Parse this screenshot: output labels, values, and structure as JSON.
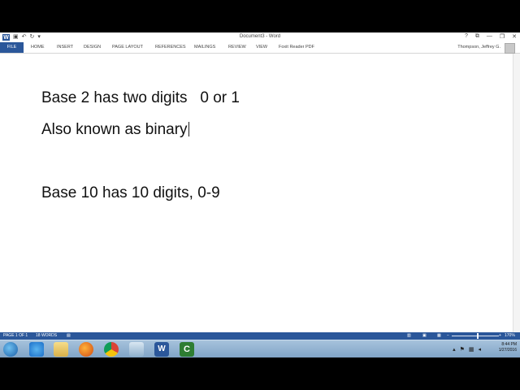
{
  "title_bar": {
    "document_title": "Document3 - Word",
    "qat": [
      "save-icon",
      "undo-icon",
      "redo-icon"
    ],
    "controls": [
      "?",
      "⧉",
      "—",
      "❐",
      "✕"
    ]
  },
  "ribbon": {
    "file_tab": "FILE",
    "tabs": [
      "HOME",
      "INSERT",
      "DESIGN",
      "PAGE LAYOUT",
      "REFERENCES",
      "MAILINGS",
      "REVIEW",
      "VIEW",
      "Foxit Reader PDF"
    ],
    "user": "Thompson, Jeffrey G."
  },
  "document": {
    "lines": [
      "Base 2 has two digits   0 or 1",
      "Also known as binary",
      "Base 10 has 10 digits, 0-9"
    ]
  },
  "status_bar": {
    "page": "PAGE 1 OF 1",
    "words": "18 WORDS",
    "zoom": "170%",
    "zoom_level_pct": 170
  },
  "taskbar": {
    "apps": [
      "start-orb",
      "internet-explorer-icon",
      "file-explorer-icon",
      "firefox-icon",
      "chrome-icon",
      "app-icon",
      "word-icon",
      "camtasia-icon"
    ],
    "time": "8:44 PM",
    "date": "1/27/2016"
  }
}
